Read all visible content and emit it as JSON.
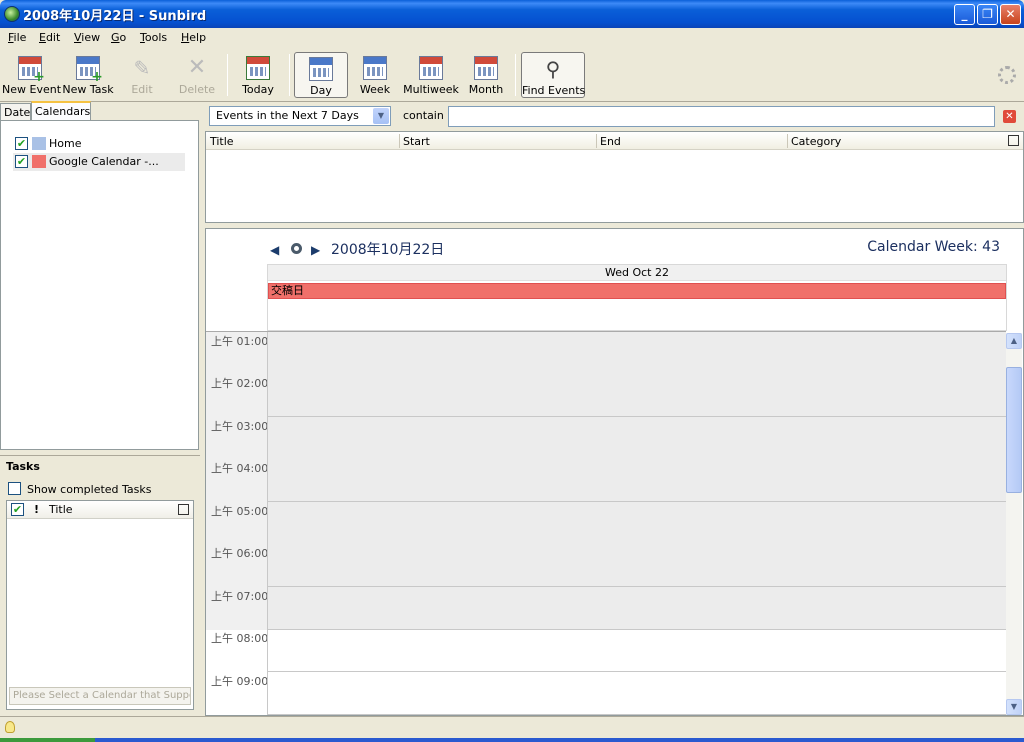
{
  "window": {
    "title": "2008年10月22日 - Sunbird",
    "minimize_icon": "_",
    "maximize_icon": "❐",
    "close_icon": "✕"
  },
  "menu": {
    "items": [
      "File",
      "Edit",
      "View",
      "Go",
      "Tools",
      "Help"
    ]
  },
  "toolbar": {
    "buttons": [
      {
        "label": "New Event",
        "icon": "new-event-icon",
        "enabled": true
      },
      {
        "label": "New Task",
        "icon": "new-task-icon",
        "enabled": true
      },
      {
        "label": "Edit",
        "icon": "pencil-icon",
        "enabled": false
      },
      {
        "label": "Delete",
        "icon": "delete-x-icon",
        "enabled": false
      },
      {
        "label": "Today",
        "icon": "today-calendar-icon",
        "enabled": true
      },
      {
        "label": "Day",
        "icon": "day-view-icon",
        "enabled": true,
        "active": true
      },
      {
        "label": "Week",
        "icon": "week-view-icon",
        "enabled": true
      },
      {
        "label": "Multiweek",
        "icon": "multiweek-view-icon",
        "enabled": true
      },
      {
        "label": "Month",
        "icon": "month-view-icon",
        "enabled": true
      },
      {
        "label": "Find Events",
        "icon": "magnifier-icon",
        "enabled": true,
        "active": true
      }
    ]
  },
  "sidebar": {
    "tabs": [
      {
        "label": "Date",
        "active": false
      },
      {
        "label": "Calendars",
        "active": true
      }
    ],
    "calendars": [
      {
        "name": "Home",
        "checked": true,
        "color": "#a9c1e6"
      },
      {
        "name": "Google Calendar -...",
        "checked": true,
        "color": "#f0706a",
        "selected": true
      }
    ]
  },
  "tasks": {
    "title": "Tasks",
    "show_completed_label": "Show completed Tasks",
    "show_completed_checked": false,
    "columns": {
      "done": "✔",
      "priority": "!",
      "title": "Title"
    },
    "new_task_placeholder": "Please Select a Calendar that Suppor"
  },
  "filter": {
    "selected": "Events in the Next 7 Days",
    "contain_label": "contain",
    "search_value": ""
  },
  "event_list": {
    "columns": [
      "Title",
      "Start",
      "End",
      "Category"
    ]
  },
  "day_view": {
    "date_title": "2008年10月22日",
    "week_label": "Calendar Week: 43",
    "day_header": "Wed Oct 22",
    "allday_events": [
      {
        "title": "交稿日",
        "color": "#f0706a"
      }
    ],
    "hours": [
      {
        "label": "上午 01:00",
        "off": true
      },
      {
        "label": "上午 02:00",
        "off": true
      },
      {
        "label": "上午 03:00",
        "off": true
      },
      {
        "label": "上午 04:00",
        "off": true
      },
      {
        "label": "上午 05:00",
        "off": true
      },
      {
        "label": "上午 06:00",
        "off": true
      },
      {
        "label": "上午 07:00",
        "off": true
      },
      {
        "label": "上午 08:00",
        "off": false
      },
      {
        "label": "上午 09:00",
        "off": false
      }
    ]
  }
}
